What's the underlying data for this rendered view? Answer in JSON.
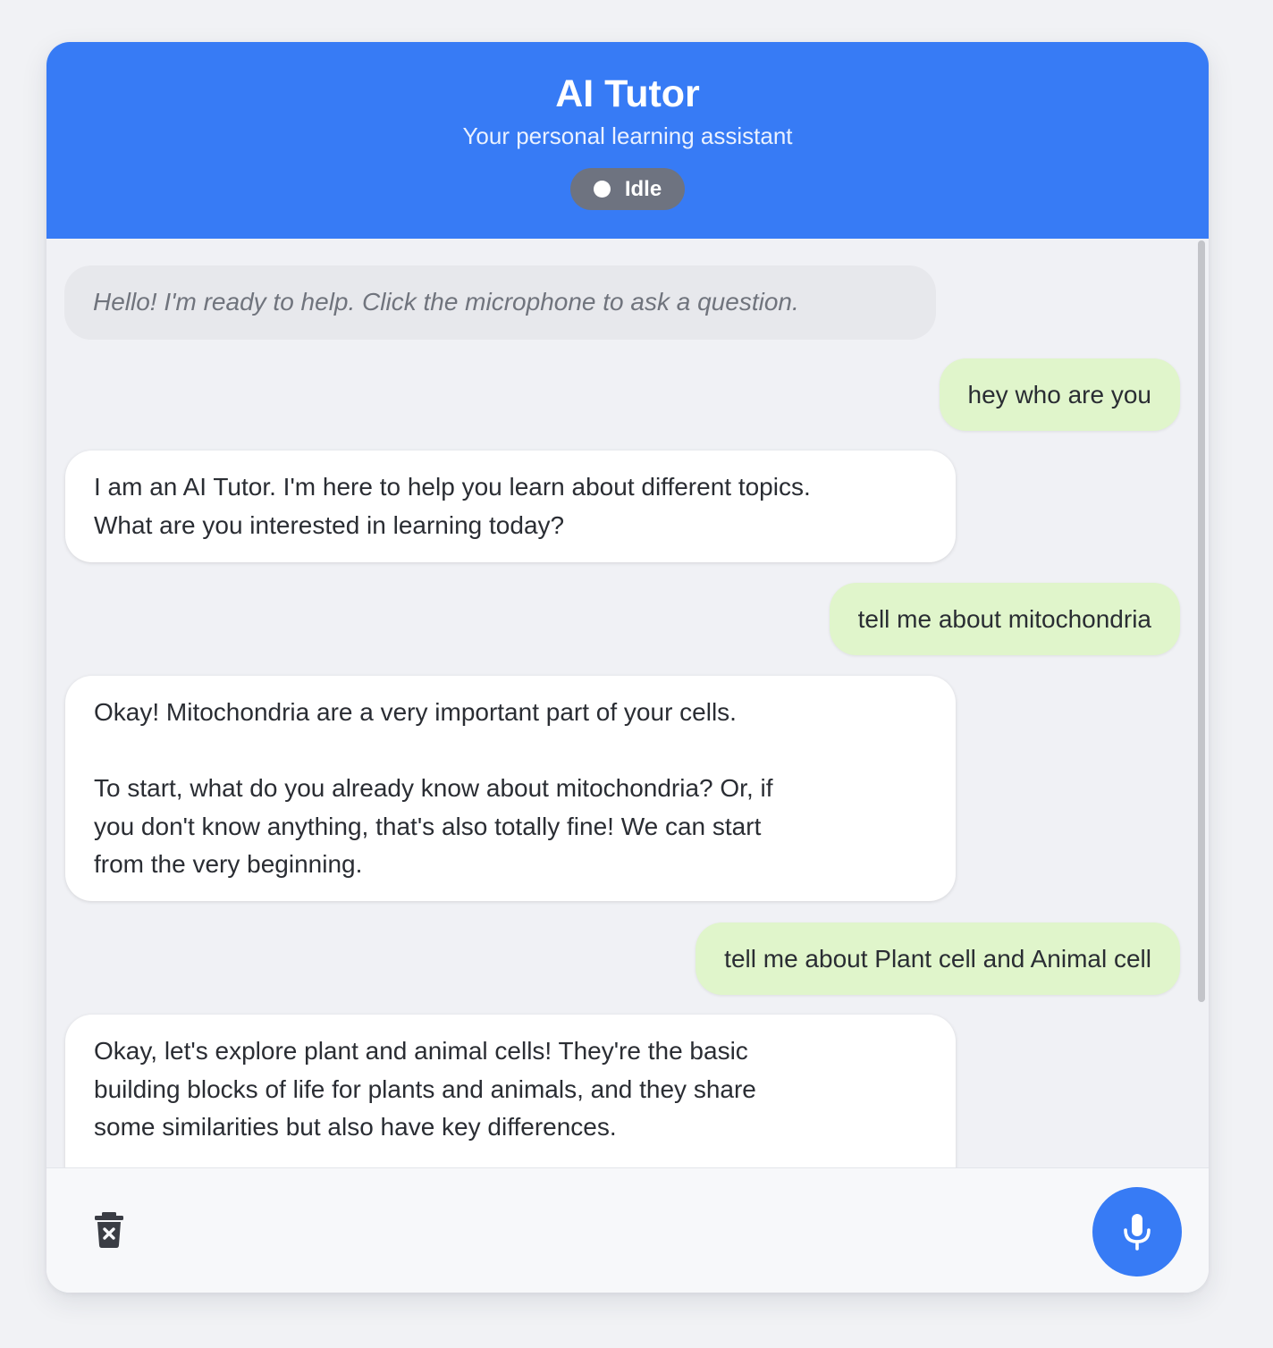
{
  "header": {
    "title": "AI Tutor",
    "subtitle": "Your personal learning assistant",
    "status": "Idle"
  },
  "messages": [
    {
      "role": "system",
      "text": "Hello! I'm ready to help. Click the microphone to ask a question."
    },
    {
      "role": "user",
      "text": "hey who are you"
    },
    {
      "role": "assistant",
      "text": "I am an AI Tutor. I'm here to help you learn about different topics.\nWhat are you interested in learning today?"
    },
    {
      "role": "user",
      "text": "tell me about mitochondria"
    },
    {
      "role": "assistant",
      "text": "Okay! Mitochondria are a very important part of your cells.\n\nTo start, what do you already know about mitochondria? Or, if\nyou don't know anything, that's also totally fine! We can start\nfrom the very beginning."
    },
    {
      "role": "user",
      "text": "tell me about Plant cell and Animal cell"
    },
    {
      "role": "assistant",
      "text": "Okay, let's explore plant and animal cells! They're the basic\nbuilding blocks of life for plants and animals, and they share\nsome similarities but also have key differences."
    }
  ],
  "footer": {
    "clear_icon": "trash-icon",
    "mic_icon": "microphone-icon"
  },
  "colors": {
    "accent": "#377bf5",
    "user_bubble": "#e0f5cb",
    "status_idle": "#6e7380"
  }
}
